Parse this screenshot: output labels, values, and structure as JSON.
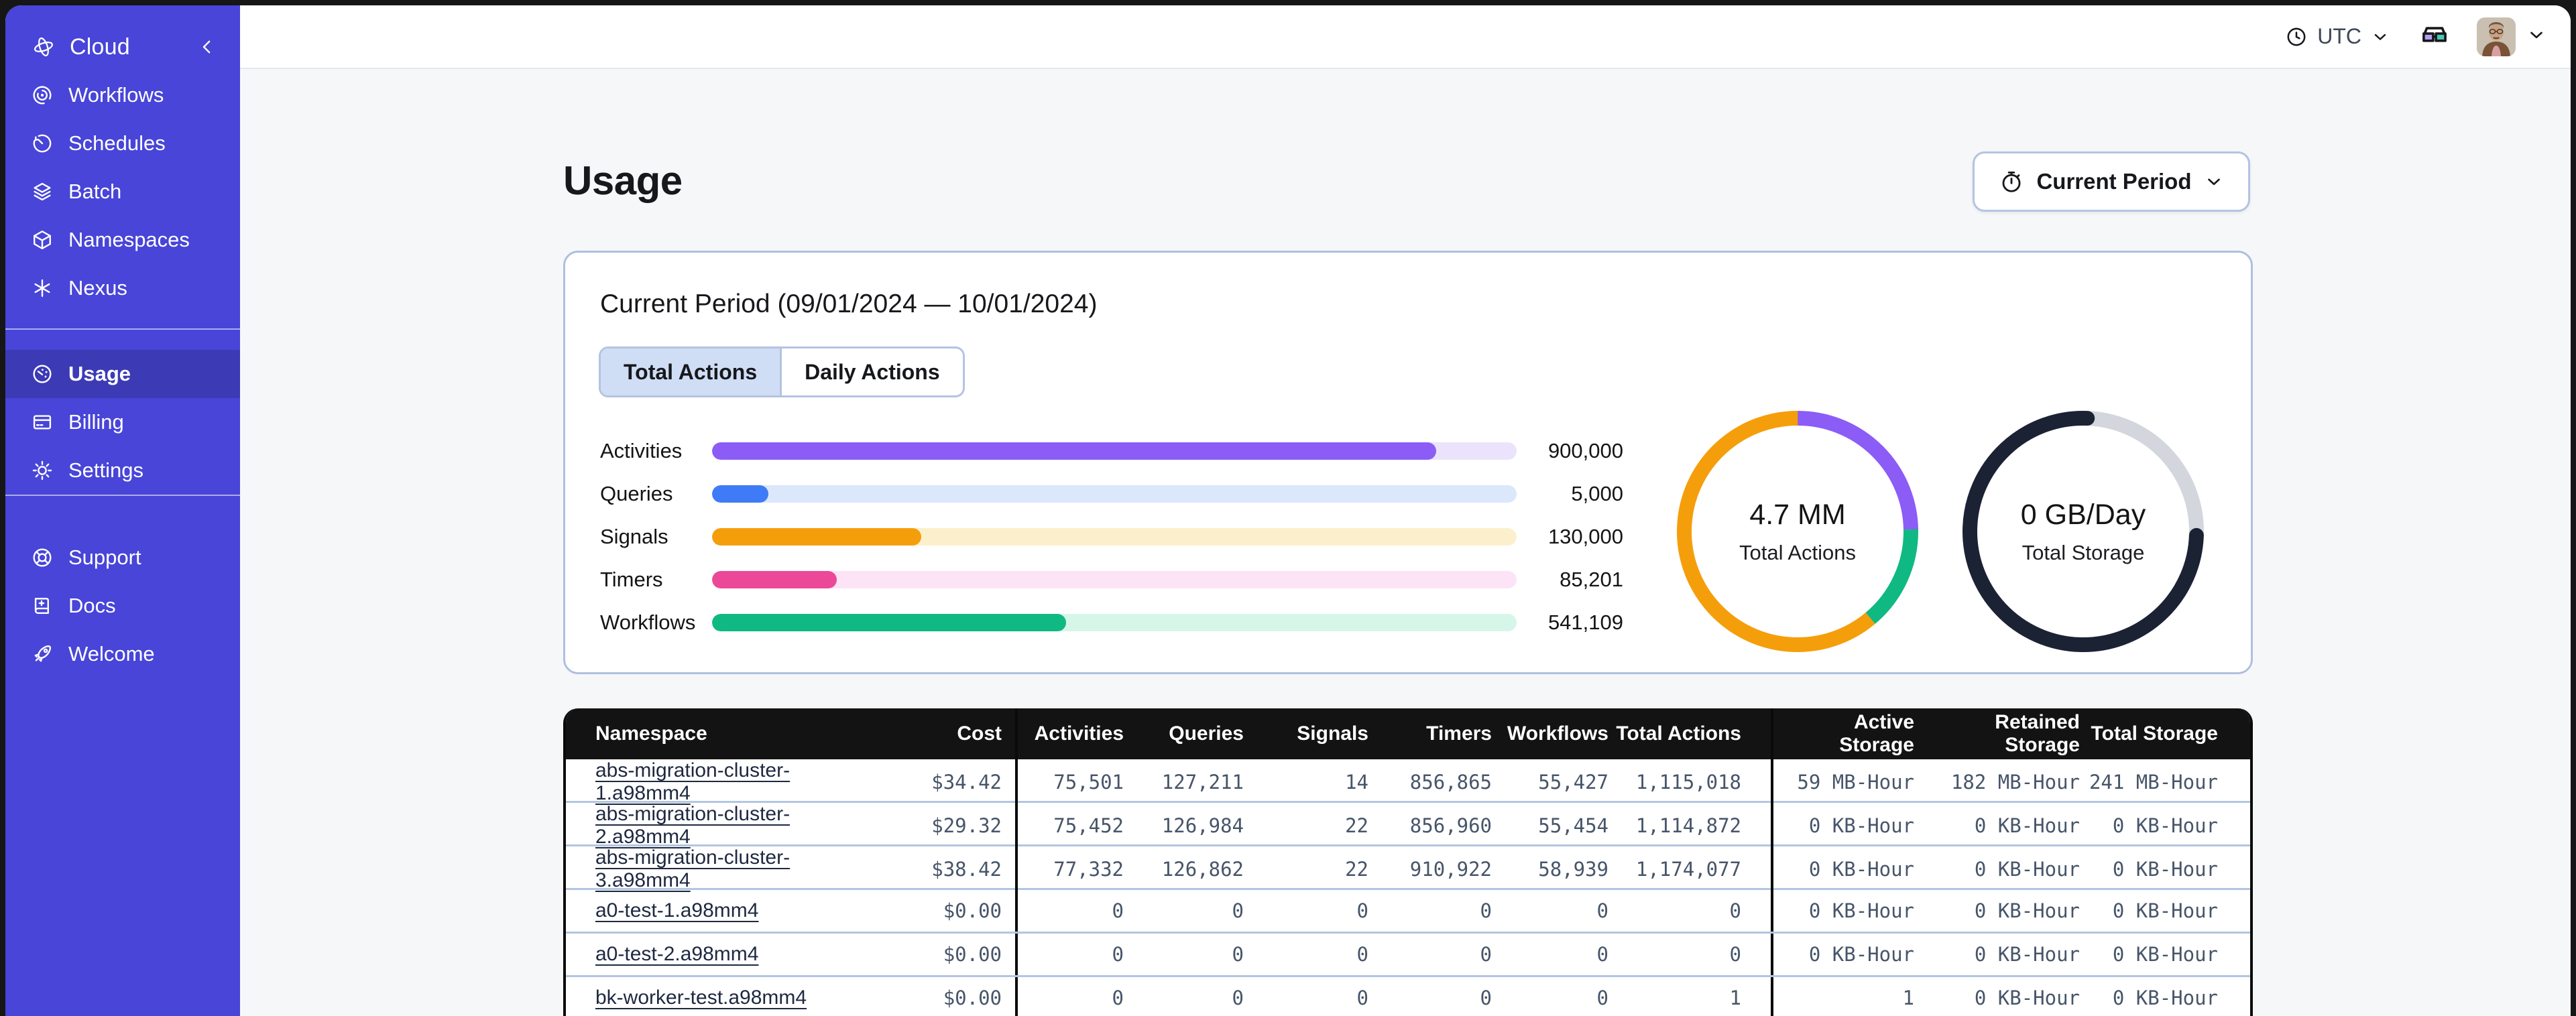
{
  "sidebar": {
    "brand": {
      "label": "Cloud"
    },
    "groups": [
      {
        "items": [
          {
            "icon": "workflows-icon",
            "label": "Workflows",
            "active": false
          },
          {
            "icon": "schedules-icon",
            "label": "Schedules",
            "active": false
          },
          {
            "icon": "batch-icon",
            "label": "Batch",
            "active": false
          },
          {
            "icon": "namespaces-icon",
            "label": "Namespaces",
            "active": false
          },
          {
            "icon": "nexus-icon",
            "label": "Nexus",
            "active": false
          }
        ]
      },
      {
        "items": [
          {
            "icon": "usage-icon",
            "label": "Usage",
            "active": true
          },
          {
            "icon": "billing-icon",
            "label": "Billing",
            "active": false
          },
          {
            "icon": "settings-icon",
            "label": "Settings",
            "active": false
          }
        ]
      },
      {
        "items": [
          {
            "icon": "support-icon",
            "label": "Support",
            "active": false
          },
          {
            "icon": "docs-icon",
            "label": "Docs",
            "active": false
          },
          {
            "icon": "welcome-icon",
            "label": "Welcome",
            "active": false
          }
        ]
      }
    ]
  },
  "header": {
    "timezone": "UTC"
  },
  "page": {
    "title": "Usage",
    "period_selector_label": "Current Period"
  },
  "card": {
    "title": "Current Period (09/01/2024 — 10/01/2024)",
    "tabs": [
      {
        "label": "Total Actions",
        "selected": true
      },
      {
        "label": "Daily Actions",
        "selected": false
      }
    ]
  },
  "chart_data": [
    {
      "type": "bar",
      "orientation": "horizontal",
      "categories": [
        "Activities",
        "Queries",
        "Signals",
        "Timers",
        "Workflows"
      ],
      "values": [
        900000,
        5000,
        130000,
        85201,
        541109
      ],
      "display_values": [
        "900,000",
        "5,000",
        "130,000",
        "85,201",
        "541,109"
      ],
      "fill_fractions": [
        0.9,
        0.07,
        0.26,
        0.155,
        0.44
      ],
      "bar_colors": [
        "#8b5cf6",
        "#3f7bf6",
        "#f59e0b",
        "#ec4899",
        "#10b981"
      ],
      "track_colors": [
        "#eae3fb",
        "#dbe7fb",
        "#fcf0cc",
        "#fce4f6",
        "#d5f6e8"
      ]
    },
    {
      "type": "donut",
      "center_value": "4.7 MM",
      "center_label": "Total Actions",
      "linecap": "butt",
      "segments": [
        {
          "name": "segment-purple",
          "color": "#8b5cf6",
          "start_deg": 0,
          "sweep_deg": 89
        },
        {
          "name": "segment-green",
          "color": "#10b981",
          "start_deg": 89,
          "sweep_deg": 51
        },
        {
          "name": "segment-orange",
          "color": "#f59e0b",
          "start_deg": 140,
          "sweep_deg": 220
        }
      ]
    },
    {
      "type": "donut",
      "center_value": "0 GB/Day",
      "center_label": "Total Storage",
      "linecap": "round",
      "segments": [
        {
          "name": "segment-gray",
          "color": "#d3d6dd",
          "start_deg": 2,
          "sweep_deg": 90
        },
        {
          "name": "segment-navy",
          "color": "#1b2234",
          "start_deg": 92,
          "sweep_deg": 270
        }
      ]
    }
  ],
  "table": {
    "columns": [
      "Namespace",
      "Cost",
      "Activities",
      "Queries",
      "Signals",
      "Timers",
      "Workflows",
      "Total Actions",
      "Active Storage",
      "Retained Storage",
      "Total Storage"
    ],
    "rows": [
      {
        "namespace": "abs-migration-cluster-1.a98mm4",
        "cells": [
          "$34.42",
          "75,501",
          "127,211",
          "14",
          "856,865",
          "55,427",
          "1,115,018",
          "59 MB-Hour",
          "182 MB-Hour",
          "241 MB-Hour"
        ]
      },
      {
        "namespace": "abs-migration-cluster-2.a98mm4",
        "cells": [
          "$29.32",
          "75,452",
          "126,984",
          "22",
          "856,960",
          "55,454",
          "1,114,872",
          "0 KB-Hour",
          "0 KB-Hour",
          "0 KB-Hour"
        ]
      },
      {
        "namespace": "abs-migration-cluster-3.a98mm4",
        "cells": [
          "$38.42",
          "77,332",
          "126,862",
          "22",
          "910,922",
          "58,939",
          "1,174,077",
          "0 KB-Hour",
          "0 KB-Hour",
          "0 KB-Hour"
        ]
      },
      {
        "namespace": "a0-test-1.a98mm4",
        "cells": [
          "$0.00",
          "0",
          "0",
          "0",
          "0",
          "0",
          "0",
          "0 KB-Hour",
          "0 KB-Hour",
          "0 KB-Hour"
        ]
      },
      {
        "namespace": "a0-test-2.a98mm4",
        "cells": [
          "$0.00",
          "0",
          "0",
          "0",
          "0",
          "0",
          "0",
          "0 KB-Hour",
          "0 KB-Hour",
          "0 KB-Hour"
        ]
      },
      {
        "namespace": "bk-worker-test.a98mm4",
        "cells": [
          "$0.00",
          "0",
          "0",
          "0",
          "0",
          "0",
          "1",
          "1",
          "0 KB-Hour",
          "0 KB-Hour",
          "0 KB-Hour"
        ]
      }
    ]
  }
}
